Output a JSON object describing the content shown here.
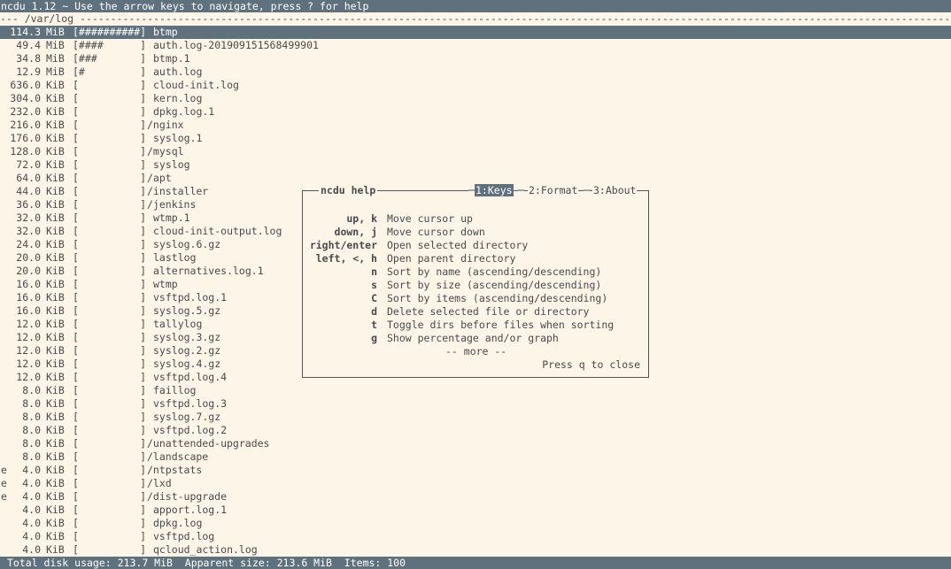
{
  "title_bar": "ncdu 1.12 ~ Use the arrow keys to navigate, press ? for help",
  "path_line": "--- /var/log -----------------------------------------------------------------------------------------------------------------------------------------------------------------------",
  "rows": [
    {
      "flag": "",
      "size": "114.3",
      "unit": "MiB",
      "graph": "[##########]",
      "name": "btmp",
      "dir": false,
      "selected": true
    },
    {
      "flag": "",
      "size": "49.4",
      "unit": "MiB",
      "graph": "[####      ]",
      "name": "auth.log-201909151568499901",
      "dir": false
    },
    {
      "flag": "",
      "size": "34.8",
      "unit": "MiB",
      "graph": "[###       ]",
      "name": "btmp.1",
      "dir": false
    },
    {
      "flag": "",
      "size": "12.9",
      "unit": "MiB",
      "graph": "[#         ]",
      "name": "auth.log",
      "dir": false
    },
    {
      "flag": "",
      "size": "636.0",
      "unit": "KiB",
      "graph": "[          ]",
      "name": "cloud-init.log",
      "dir": false
    },
    {
      "flag": "",
      "size": "304.0",
      "unit": "KiB",
      "graph": "[          ]",
      "name": "kern.log",
      "dir": false
    },
    {
      "flag": "",
      "size": "232.0",
      "unit": "KiB",
      "graph": "[          ]",
      "name": "dpkg.log.1",
      "dir": false
    },
    {
      "flag": "",
      "size": "216.0",
      "unit": "KiB",
      "graph": "[          ]",
      "name": "/nginx",
      "dir": true
    },
    {
      "flag": "",
      "size": "176.0",
      "unit": "KiB",
      "graph": "[          ]",
      "name": "syslog.1",
      "dir": false
    },
    {
      "flag": "",
      "size": "128.0",
      "unit": "KiB",
      "graph": "[          ]",
      "name": "/mysql",
      "dir": true
    },
    {
      "flag": "",
      "size": "72.0",
      "unit": "KiB",
      "graph": "[          ]",
      "name": "syslog",
      "dir": false
    },
    {
      "flag": "",
      "size": "64.0",
      "unit": "KiB",
      "graph": "[          ]",
      "name": "/apt",
      "dir": true
    },
    {
      "flag": "",
      "size": "44.0",
      "unit": "KiB",
      "graph": "[          ]",
      "name": "/installer",
      "dir": true
    },
    {
      "flag": "",
      "size": "36.0",
      "unit": "KiB",
      "graph": "[          ]",
      "name": "/jenkins",
      "dir": true
    },
    {
      "flag": "",
      "size": "32.0",
      "unit": "KiB",
      "graph": "[          ]",
      "name": "wtmp.1",
      "dir": false
    },
    {
      "flag": "",
      "size": "32.0",
      "unit": "KiB",
      "graph": "[          ]",
      "name": "cloud-init-output.log",
      "dir": false
    },
    {
      "flag": "",
      "size": "24.0",
      "unit": "KiB",
      "graph": "[          ]",
      "name": "syslog.6.gz",
      "dir": false
    },
    {
      "flag": "",
      "size": "20.0",
      "unit": "KiB",
      "graph": "[          ]",
      "name": "lastlog",
      "dir": false
    },
    {
      "flag": "",
      "size": "20.0",
      "unit": "KiB",
      "graph": "[          ]",
      "name": "alternatives.log.1",
      "dir": false
    },
    {
      "flag": "",
      "size": "16.0",
      "unit": "KiB",
      "graph": "[          ]",
      "name": "wtmp",
      "dir": false
    },
    {
      "flag": "",
      "size": "16.0",
      "unit": "KiB",
      "graph": "[          ]",
      "name": "vsftpd.log.1",
      "dir": false
    },
    {
      "flag": "",
      "size": "16.0",
      "unit": "KiB",
      "graph": "[          ]",
      "name": "syslog.5.gz",
      "dir": false
    },
    {
      "flag": "",
      "size": "12.0",
      "unit": "KiB",
      "graph": "[          ]",
      "name": "tallylog",
      "dir": false
    },
    {
      "flag": "",
      "size": "12.0",
      "unit": "KiB",
      "graph": "[          ]",
      "name": "syslog.3.gz",
      "dir": false
    },
    {
      "flag": "",
      "size": "12.0",
      "unit": "KiB",
      "graph": "[          ]",
      "name": "syslog.2.gz",
      "dir": false
    },
    {
      "flag": "",
      "size": "12.0",
      "unit": "KiB",
      "graph": "[          ]",
      "name": "syslog.4.gz",
      "dir": false
    },
    {
      "flag": "",
      "size": "12.0",
      "unit": "KiB",
      "graph": "[          ]",
      "name": "vsftpd.log.4",
      "dir": false
    },
    {
      "flag": "",
      "size": "8.0",
      "unit": "KiB",
      "graph": "[          ]",
      "name": "faillog",
      "dir": false
    },
    {
      "flag": "",
      "size": "8.0",
      "unit": "KiB",
      "graph": "[          ]",
      "name": "vsftpd.log.3",
      "dir": false
    },
    {
      "flag": "",
      "size": "8.0",
      "unit": "KiB",
      "graph": "[          ]",
      "name": "syslog.7.gz",
      "dir": false
    },
    {
      "flag": "",
      "size": "8.0",
      "unit": "KiB",
      "graph": "[          ]",
      "name": "vsftpd.log.2",
      "dir": false
    },
    {
      "flag": "",
      "size": "8.0",
      "unit": "KiB",
      "graph": "[          ]",
      "name": "/unattended-upgrades",
      "dir": true
    },
    {
      "flag": "",
      "size": "8.0",
      "unit": "KiB",
      "graph": "[          ]",
      "name": "/landscape",
      "dir": true
    },
    {
      "flag": "e",
      "size": "4.0",
      "unit": "KiB",
      "graph": "[          ]",
      "name": "/ntpstats",
      "dir": true
    },
    {
      "flag": "e",
      "size": "4.0",
      "unit": "KiB",
      "graph": "[          ]",
      "name": "/lxd",
      "dir": true
    },
    {
      "flag": "e",
      "size": "4.0",
      "unit": "KiB",
      "graph": "[          ]",
      "name": "/dist-upgrade",
      "dir": true
    },
    {
      "flag": "",
      "size": "4.0",
      "unit": "KiB",
      "graph": "[          ]",
      "name": "apport.log.1",
      "dir": false
    },
    {
      "flag": "",
      "size": "4.0",
      "unit": "KiB",
      "graph": "[          ]",
      "name": "dpkg.log",
      "dir": false
    },
    {
      "flag": "",
      "size": "4.0",
      "unit": "KiB",
      "graph": "[          ]",
      "name": "vsftpd.log",
      "dir": false
    },
    {
      "flag": "",
      "size": "4.0",
      "unit": "KiB",
      "graph": "[          ]",
      "name": "qcloud_action.log",
      "dir": false
    }
  ],
  "help": {
    "title": "ncdu help",
    "tabs": [
      "1:Keys",
      "2:Format",
      "3:About"
    ],
    "keys": [
      {
        "key": "up, k",
        "desc": "Move cursor up"
      },
      {
        "key": "down, j",
        "desc": "Move cursor down"
      },
      {
        "key": "right/enter",
        "desc": "Open selected directory"
      },
      {
        "key": "left, <, h",
        "desc": "Open parent directory"
      },
      {
        "key": "n",
        "desc": "Sort by name (ascending/descending)"
      },
      {
        "key": "s",
        "desc": "Sort by size (ascending/descending)"
      },
      {
        "key": "C",
        "desc": "Sort by items (ascending/descending)"
      },
      {
        "key": "d",
        "desc": "Delete selected file or directory"
      },
      {
        "key": "t",
        "desc": "Toggle dirs before files when sorting"
      },
      {
        "key": "g",
        "desc": "Show percentage and/or graph"
      }
    ],
    "more": "-- more --",
    "close_hint": "Press q to close"
  },
  "status_bar": "Total disk usage: 213.7 MiB  Apparent size: 213.6 MiB  Items: 100",
  "colors": {
    "background": "#fdf6e8",
    "bar": "#5f717d",
    "text": "#4a4a4a"
  }
}
